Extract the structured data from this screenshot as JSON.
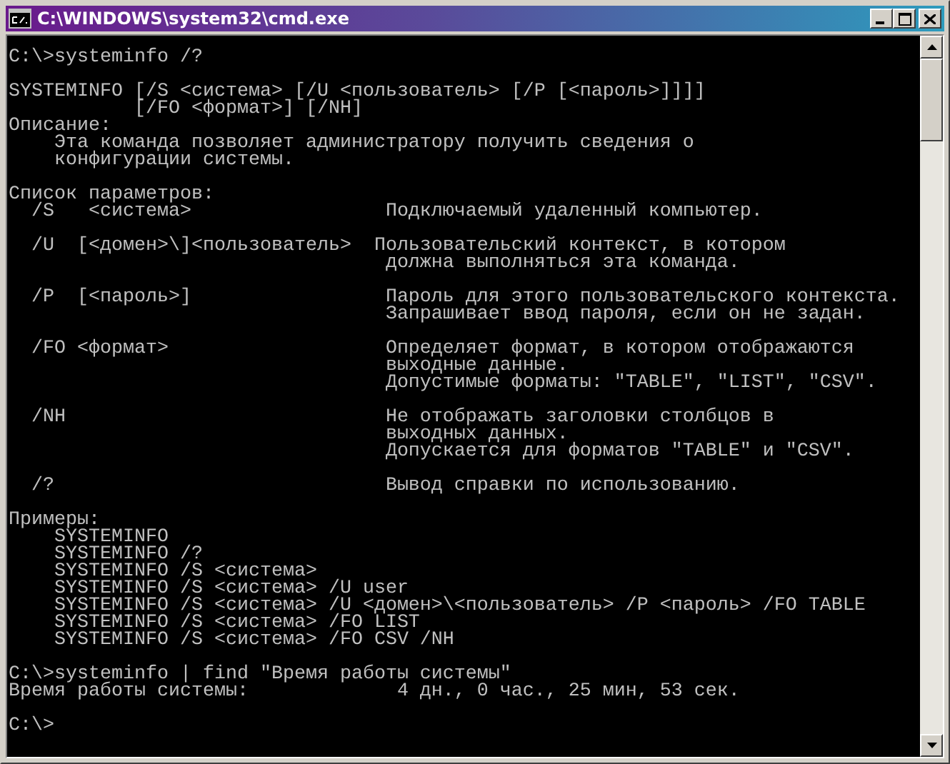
{
  "window": {
    "title": "C:\\WINDOWS\\system32\\cmd.exe"
  },
  "console": {
    "blocks": [
      [
        "C:\\>systeminfo /?"
      ],
      [
        "SYSTEMINFO [/S <система> [/U <пользователь> [/P [<пароль>]]]]",
        "           [/FO <формат>] [/NH]",
        "Описание:",
        "    Эта команда позволяет администратору получить сведения о",
        "    конфигурации системы."
      ],
      [
        "Список параметров:",
        "  /S   <система>                 Подключаемый удаленный компьютер."
      ],
      [
        "  /U  [<домен>\\]<пользователь>  Пользовательский контекст, в котором",
        "                                 должна выполняться эта команда."
      ],
      [
        "  /P  [<пароль>]                 Пароль для этого пользовательского контекста.",
        "                                 Запрашивает ввод пароля, если он не задан."
      ],
      [
        "  /FO <формат>                   Определяет формат, в котором отображаются",
        "                                 выходные данные.",
        "                                 Допустимые форматы: \"TABLE\", \"LIST\", \"CSV\"."
      ],
      [
        "  /NH                            Не отображать заголовки столбцов в",
        "                                 выходных данных.",
        "                                 Допускается для форматов \"TABLE\" и \"CSV\"."
      ],
      [
        "  /?                             Вывод справки по использованию."
      ],
      [
        "Примеры:",
        "    SYSTEMINFO",
        "    SYSTEMINFO /?",
        "    SYSTEMINFO /S <система>",
        "    SYSTEMINFO /S <система> /U user",
        "    SYSTEMINFO /S <система> /U <домен>\\<пользователь> /P <пароль> /FO TABLE",
        "    SYSTEMINFO /S <система> /FO LIST",
        "    SYSTEMINFO /S <система> /FO CSV /NH"
      ],
      [
        "C:\\>systeminfo | find \"Время работы системы\"",
        "Время работы системы:             4 дн., 0 час., 25 мин, 53 сек."
      ],
      [
        "C:\\>"
      ]
    ]
  }
}
